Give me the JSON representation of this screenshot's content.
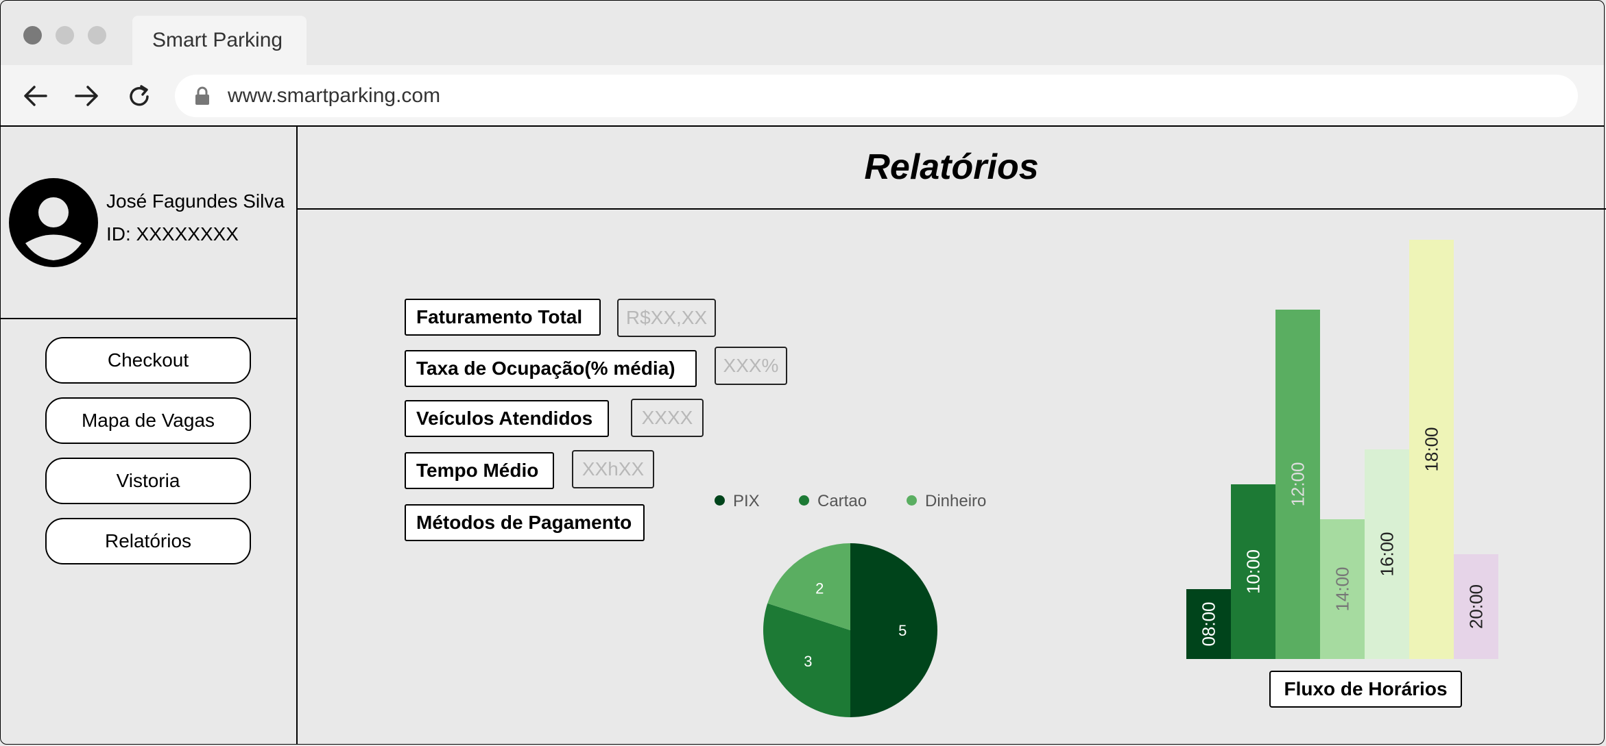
{
  "browser": {
    "tab_title": "Smart Parking",
    "url": "www.smartparking.com"
  },
  "user": {
    "name": "José Fagundes Silva",
    "id": "ID: XXXXXXXX"
  },
  "nav": {
    "items": [
      {
        "label": "Checkout"
      },
      {
        "label": "Mapa de Vagas"
      },
      {
        "label": "Vistoria"
      },
      {
        "label": "Relatórios"
      }
    ]
  },
  "page": {
    "title": "Relatórios"
  },
  "metrics": [
    {
      "label": "Faturamento Total",
      "value": "R$XX,XX"
    },
    {
      "label": "Taxa de Ocupação(% média)",
      "value": "XXX%"
    },
    {
      "label": "Veículos Atendidos",
      "value": "XXXX"
    },
    {
      "label": "Tempo Médio",
      "value": "XXhXX"
    },
    {
      "label": "Métodos de Pagamento"
    }
  ],
  "chart_data": [
    {
      "type": "pie",
      "legend": [
        "PIX",
        "Cartao",
        "Dinheiro"
      ],
      "values": [
        5,
        3,
        2
      ],
      "colors": [
        "#00441b",
        "#1d7a35",
        "#5aae61"
      ],
      "legend_position": "top"
    },
    {
      "type": "bar",
      "title": "Fluxo de Horários",
      "categories": [
        "08:00",
        "10:00",
        "12:00",
        "14:00",
        "16:00",
        "18:00",
        "20:00"
      ],
      "values": [
        1.0,
        2.5,
        5.0,
        2.0,
        3.0,
        6.0,
        1.5
      ],
      "colors": [
        "#00441b",
        "#1d7a35",
        "#5aae61",
        "#a6dba0",
        "#d9f0d3",
        "#eef4b7",
        "#e6d4e8"
      ],
      "label_colors": [
        "#ffffff",
        "#ffffff",
        "#dddddd",
        "#777777",
        "#222222",
        "#222222",
        "#222222"
      ]
    }
  ]
}
